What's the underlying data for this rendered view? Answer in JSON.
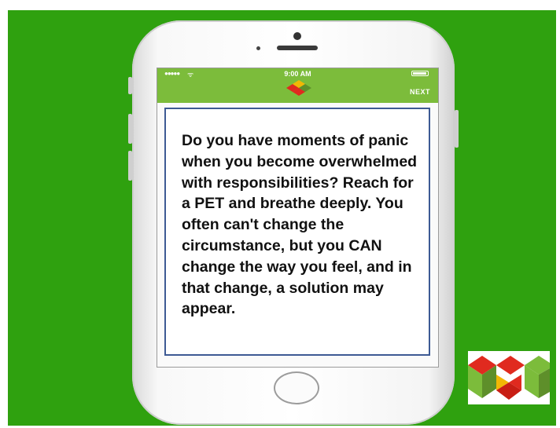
{
  "status_bar": {
    "signal": "●●●●● ",
    "wifi": "ᯤ",
    "time": "9:00 AM"
  },
  "header": {
    "next_label": "NEXT"
  },
  "card": {
    "message": "Do you have moments of panic when you become overwhelmed with responsibilities? Reach for a PET and breathe deeply. You often can't change the circumstance, but you CAN change the way you feel, and in that change, a solution may appear."
  },
  "colors": {
    "background": "#2fa10f",
    "app_bar": "#7cbc3b",
    "card_border": "#3d5a94",
    "logo_red": "#e02a1f",
    "logo_green": "#7cbc3b",
    "logo_yellow": "#f2b705"
  },
  "icons": [
    "wifi-icon",
    "battery-icon",
    "app-logo-icon",
    "home-button-icon",
    "brand-logo-icon"
  ]
}
